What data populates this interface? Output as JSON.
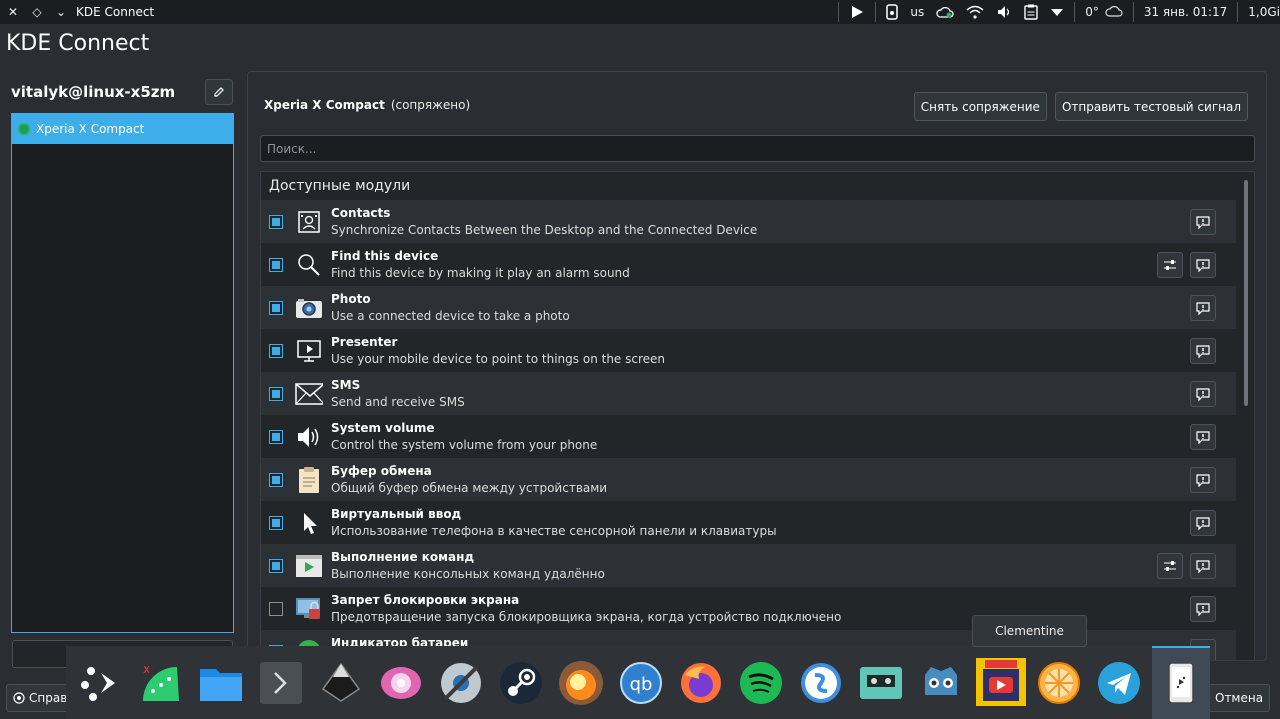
{
  "topbar": {
    "window_title": "KDE Connect",
    "layout": "us",
    "temperature": "0°",
    "datetime": "31 янв. 01:17",
    "memory": "1,0Gi"
  },
  "app_title": "KDE Connect",
  "sidebar": {
    "user": "vitalyk@linux-x5zm",
    "devices": [
      {
        "name": "Xperia X Compact"
      }
    ]
  },
  "device": {
    "name": "Xperia X Compact",
    "status": "(сопряжено)",
    "unpair_label": "Снять сопряжение",
    "ping_label": "Отправить тестовый сигнал"
  },
  "search": {
    "placeholder": "Поиск..."
  },
  "modules": {
    "heading": "Доступные модули",
    "items": [
      {
        "name": "Contacts",
        "desc": "Synchronize Contacts Between the Desktop and the Connected Device",
        "enabled": true,
        "configurable": false,
        "icon": "contacts-icon"
      },
      {
        "name": "Find this device",
        "desc": "Find this device by making it play an alarm sound",
        "enabled": true,
        "configurable": true,
        "icon": "search-icon"
      },
      {
        "name": "Photo",
        "desc": "Use a connected device to take a photo",
        "enabled": true,
        "configurable": false,
        "icon": "camera-icon"
      },
      {
        "name": "Presenter",
        "desc": "Use your mobile device to point to things on the screen",
        "enabled": true,
        "configurable": false,
        "icon": "presenter-icon"
      },
      {
        "name": "SMS",
        "desc": "Send and receive SMS",
        "enabled": true,
        "configurable": false,
        "icon": "mail-icon"
      },
      {
        "name": "System volume",
        "desc": "Control the system volume from your phone",
        "enabled": true,
        "configurable": false,
        "icon": "speaker-icon"
      },
      {
        "name": "Буфер обмена",
        "desc": "Общий буфер обмена между устройствами",
        "enabled": true,
        "configurable": false,
        "icon": "clipboard-icon"
      },
      {
        "name": "Виртуальный ввод",
        "desc": "Использование телефона в качестве сенсорной панели и клавиатуры",
        "enabled": true,
        "configurable": false,
        "icon": "pointer-icon"
      },
      {
        "name": "Выполнение команд",
        "desc": "Выполнение консольных команд удалённо",
        "enabled": true,
        "configurable": true,
        "icon": "run-command-icon"
      },
      {
        "name": "Запрет блокировки экрана",
        "desc": "Предотвращение запуска блокировщика экрана, когда устройство подключено",
        "enabled": false,
        "configurable": false,
        "icon": "screen-lock-icon"
      },
      {
        "name": "Индикатор батареи",
        "desc": "",
        "enabled": true,
        "configurable": false,
        "icon": "battery-icon"
      }
    ]
  },
  "footer": {
    "help_label": "Справ",
    "cancel_label": "Отмена"
  },
  "dock": {
    "tooltip": "Clementine"
  },
  "colors": {
    "accent": "#3daee9",
    "background": "#2a2e32",
    "panel": "#232629"
  }
}
